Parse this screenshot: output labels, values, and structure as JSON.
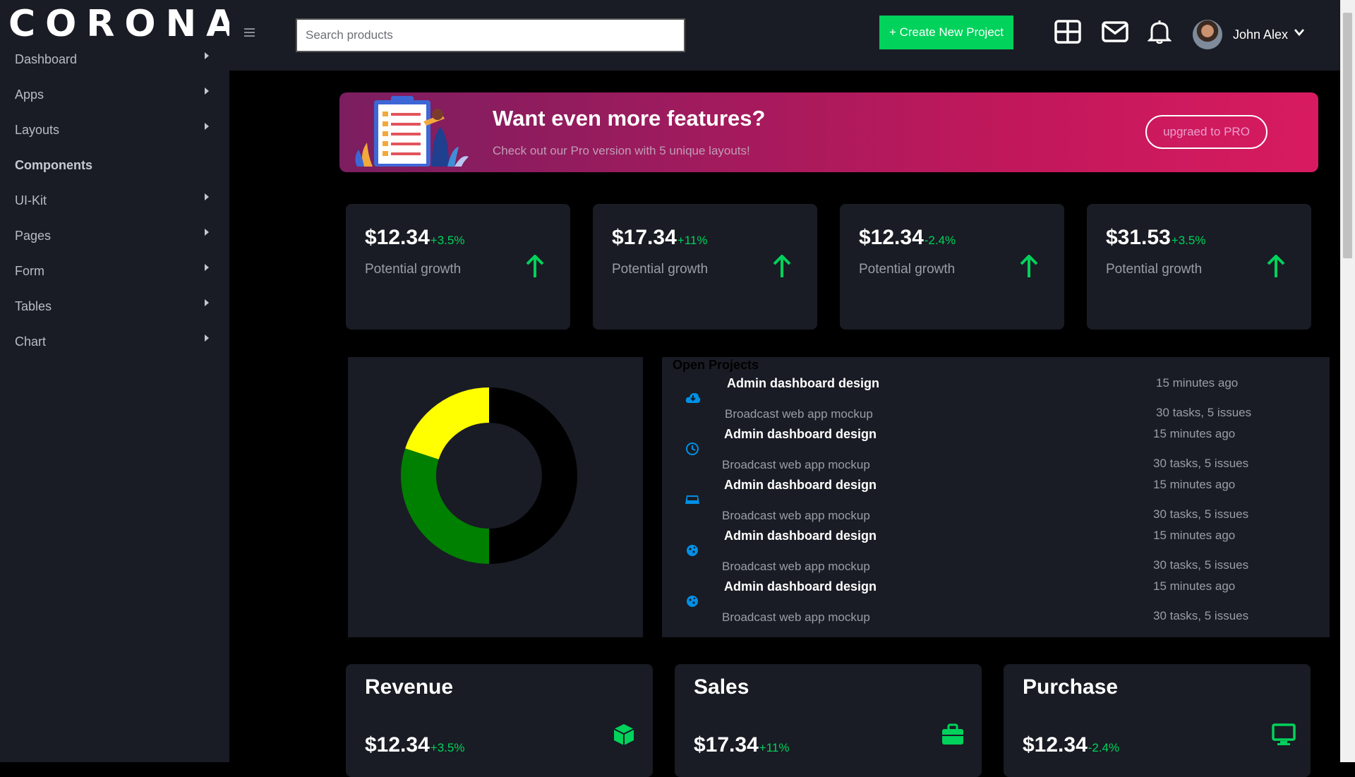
{
  "brand": "CORONA",
  "sidebar": {
    "items": [
      {
        "label": "Dashboard",
        "has_caret": true
      },
      {
        "label": "Apps",
        "has_caret": true
      },
      {
        "label": "Layouts",
        "has_caret": true
      },
      {
        "label": "Components",
        "has_caret": false
      },
      {
        "label": "UI-Kit",
        "has_caret": true
      },
      {
        "label": "Pages",
        "has_caret": true
      },
      {
        "label": "Form",
        "has_caret": true
      },
      {
        "label": "Tables",
        "has_caret": true
      },
      {
        "label": "Chart",
        "has_caret": true
      }
    ]
  },
  "navbar": {
    "search_placeholder": "Search products",
    "create_label": "+ Create New Project",
    "user_name": "John Alex",
    "icons": [
      "grid-icon",
      "mail-icon",
      "bell-icon"
    ]
  },
  "banner": {
    "title": "Want even more features?",
    "subtitle": "Check out our Pro version with 5 unique layouts!",
    "button_label": "upgraed to PRO"
  },
  "stats": [
    {
      "value": "$12.34",
      "pct": "+3.5%",
      "label": "Potential growth"
    },
    {
      "value": "$17.34",
      "pct": "+11%",
      "label": "Potential growth"
    },
    {
      "value": "$12.34",
      "pct": "-2.4%",
      "label": "Potential growth"
    },
    {
      "value": "$31.53",
      "pct": "+3.5%",
      "label": "Potential growth"
    }
  ],
  "donut": {
    "segments": [
      {
        "color": "#000000",
        "fraction": 0.5
      },
      {
        "color": "#008000",
        "fraction": 0.3
      },
      {
        "color": "#ffff00",
        "fraction": 0.2
      }
    ]
  },
  "projects": {
    "title": "Open Projects",
    "items": [
      {
        "title": "Admin dashboard design",
        "sub": "Broadcast web app mockup",
        "time": "15 minutes ago",
        "meta": "30 tasks, 5 issues",
        "icon": "cloud-download-icon"
      },
      {
        "title": "Admin dashboard design",
        "sub": "Broadcast web app mockup",
        "time": "15 minutes ago",
        "meta": "30 tasks, 5 issues",
        "icon": "clock-icon"
      },
      {
        "title": "Admin dashboard design",
        "sub": "Broadcast web app mockup",
        "time": "15 minutes ago",
        "meta": "30 tasks, 5 issues",
        "icon": "inbox-icon"
      },
      {
        "title": "Admin dashboard design",
        "sub": "Broadcast web app mockup",
        "time": "15 minutes ago",
        "meta": "30 tasks, 5 issues",
        "icon": "cookie-icon"
      },
      {
        "title": "Admin dashboard design",
        "sub": "Broadcast web app mockup",
        "time": "15 minutes ago",
        "meta": "30 tasks, 5 issues",
        "icon": "cookie-icon"
      }
    ]
  },
  "bottom_cards": [
    {
      "title": "Revenue",
      "value": "$12.34",
      "pct": "+3.5%",
      "icon": "cube-icon"
    },
    {
      "title": "Sales",
      "value": "$17.34",
      "pct": "+11%",
      "icon": "briefcase-icon"
    },
    {
      "title": "Purchase",
      "value": "$12.34",
      "pct": "-2.4%",
      "icon": "monitor-icon"
    }
  ],
  "colors": {
    "accent_green": "#00d25b",
    "panel": "#191c24",
    "banner_pink": "#d81b60",
    "icon_blue": "#0090e7"
  }
}
